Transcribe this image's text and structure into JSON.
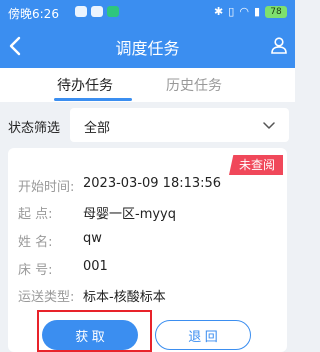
{
  "status_bar": {
    "time": "傍晚6:26",
    "battery": "78",
    "icons": [
      "notification-icon",
      "sim-icon",
      "app-icon",
      "bluetooth-icon",
      "vibrate-icon",
      "wifi-icon",
      "signal-icon",
      "battery-icon"
    ]
  },
  "nav": {
    "title": "调度任务",
    "back_icon": "chevron-left-icon",
    "user_icon": "user-icon"
  },
  "tabs": [
    {
      "label": "待办任务",
      "active": true
    },
    {
      "label": "历史任务",
      "active": false
    }
  ],
  "filter": {
    "label": "状态筛选",
    "value": "全部"
  },
  "task": {
    "badge": "未查阅",
    "fields": [
      {
        "label": "开始时间:",
        "value": "2023-03-09 18:13:56"
      },
      {
        "label": "起    点:",
        "value": "母婴一区-myyq"
      },
      {
        "label": "姓    名:",
        "value": "qw"
      },
      {
        "label": "床    号:",
        "value": "001"
      },
      {
        "label": "运送类型:",
        "value": "标本-核酸标本"
      }
    ],
    "buttons": {
      "get": "获 取",
      "return": "退 回"
    }
  },
  "colors": {
    "primary": "#3b8ef0",
    "badge": "#f0485a",
    "highlight": "#e8232a"
  }
}
